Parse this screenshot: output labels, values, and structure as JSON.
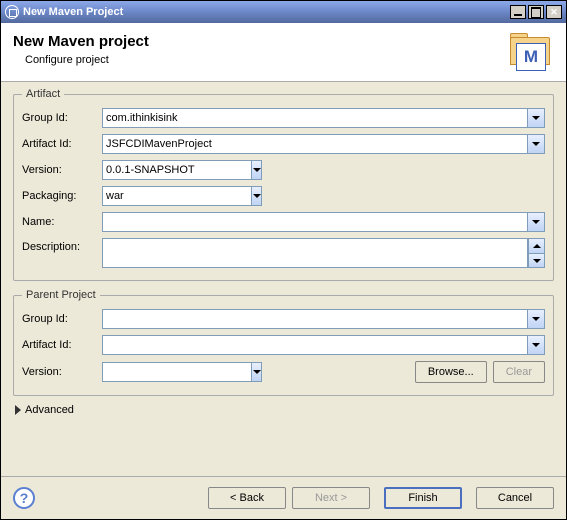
{
  "window": {
    "title": "New Maven Project"
  },
  "header": {
    "title": "New Maven project",
    "subtitle": "Configure project"
  },
  "artifact": {
    "legend": "Artifact",
    "labels": {
      "groupId": "Group Id:",
      "artifactId": "Artifact Id:",
      "version": "Version:",
      "packaging": "Packaging:",
      "name": "Name:",
      "description": "Description:"
    },
    "values": {
      "groupId": "com.ithinkisink",
      "artifactId": "JSFCDIMavenProject",
      "version": "0.0.1-SNAPSHOT",
      "packaging": "war",
      "name": "",
      "description": ""
    }
  },
  "parent": {
    "legend": "Parent Project",
    "labels": {
      "groupId": "Group Id:",
      "artifactId": "Artifact Id:",
      "version": "Version:"
    },
    "values": {
      "groupId": "",
      "artifactId": "",
      "version": ""
    },
    "buttons": {
      "browse": "Browse...",
      "clear": "Clear"
    }
  },
  "advanced": {
    "label": "Advanced"
  },
  "footer": {
    "back": "< Back",
    "next": "Next >",
    "finish": "Finish",
    "cancel": "Cancel"
  },
  "icon": {
    "letter": "M"
  }
}
